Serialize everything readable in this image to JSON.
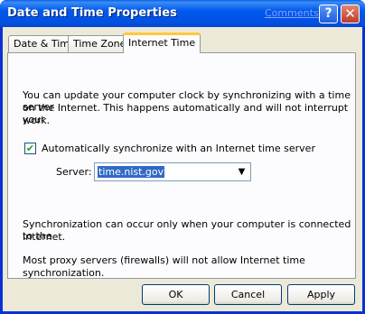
{
  "window": {
    "title": "Date and Time Properties",
    "comments_link": "Comments?",
    "help_button": "?",
    "close_button": "✕"
  },
  "tabs": [
    {
      "label": "Date & Time",
      "active": false
    },
    {
      "label": "Time Zone",
      "active": false
    },
    {
      "label": "Internet Time",
      "active": true
    }
  ],
  "internet_time": {
    "intro_line1": "You can update your computer clock by synchronizing with a time server",
    "intro_line2": "on the Internet.  This happens automatically and will not interrupt your",
    "intro_line3": "work.",
    "auto_sync_label": "Automatically synchronize with an Internet time server",
    "auto_sync_checked": true,
    "server_label": "Server:",
    "server_value": "time.nist.gov",
    "note1_line1": "Synchronization can occur only when your computer is connected to the",
    "note1_line2": "Internet.",
    "note2_line1": "Most proxy servers (firewalls) will not allow Internet time",
    "note2_line2": "synchronization."
  },
  "buttons": {
    "ok": "OK",
    "cancel": "Cancel",
    "apply": "Apply"
  }
}
